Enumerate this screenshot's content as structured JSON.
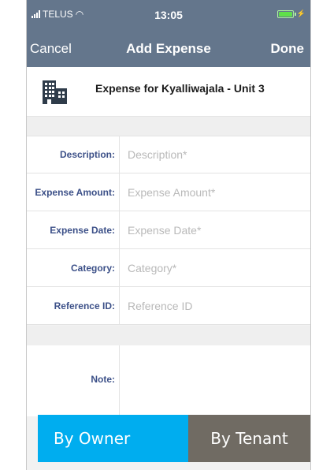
{
  "status_bar": {
    "carrier": "TELUS",
    "time": "13:05",
    "wifi_icon": "wifi-icon",
    "battery_icon": "battery-charging-icon"
  },
  "nav": {
    "cancel_label": "Cancel",
    "title": "Add Expense",
    "done_label": "Done",
    "background_color": "#64768c"
  },
  "property": {
    "icon": "building-icon",
    "title": "Expense for Kyalliwajala  - Unit 3"
  },
  "form": {
    "label_color": "#3c5088",
    "fields": [
      {
        "label": "Description:",
        "placeholder": "Description*",
        "value": ""
      },
      {
        "label": "Expense Amount:",
        "placeholder": "Expense Amount*",
        "value": ""
      },
      {
        "label": "Expense Date:",
        "placeholder": "Expense Date*",
        "value": ""
      },
      {
        "label": "Category:",
        "placeholder": "Category*",
        "value": ""
      },
      {
        "label": "Reference ID:",
        "placeholder": "Reference ID",
        "value": ""
      }
    ],
    "note": {
      "label": "Note:",
      "value": ""
    }
  },
  "payer_toggle": {
    "owner_label": "By Owner",
    "tenant_label": "By Tenant",
    "owner_color": "#00adef",
    "tenant_color": "#706b63",
    "selected": "By Owner"
  }
}
